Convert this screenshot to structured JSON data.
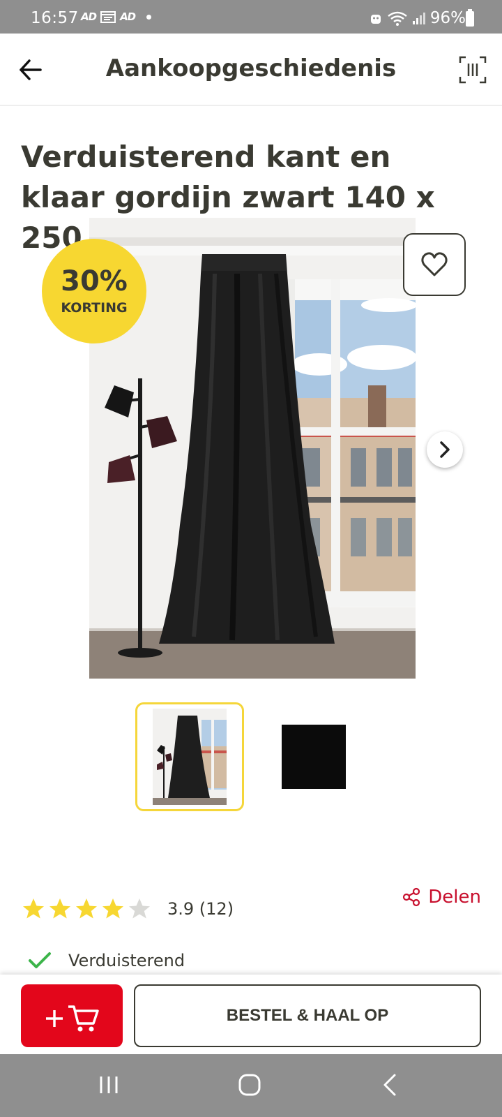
{
  "status_bar": {
    "time": "16:57",
    "badges": [
      "AD",
      "AD"
    ],
    "battery": "96%"
  },
  "header": {
    "title": "Aankoopgeschiedenis",
    "back_icon": "arrow-left-icon",
    "scan_icon": "barcode-scan-icon"
  },
  "product": {
    "title": "Verduisterend kant en klaar gordijn zwart 140 x 250 cm",
    "discount_percent": "30%",
    "discount_label": "KORTING",
    "rating_text": "3.9 (12)",
    "rating_value": 3.9,
    "rating_max": 5,
    "share_label": "Delen",
    "usp": "Verduisterend"
  },
  "actions": {
    "order_label": "BESTEL & HAAL OP"
  },
  "colors": {
    "brand_red": "#e3061b",
    "discount_yellow": "#f7d731",
    "text_dark": "#3a3a32",
    "check_green": "#3cb44a"
  }
}
